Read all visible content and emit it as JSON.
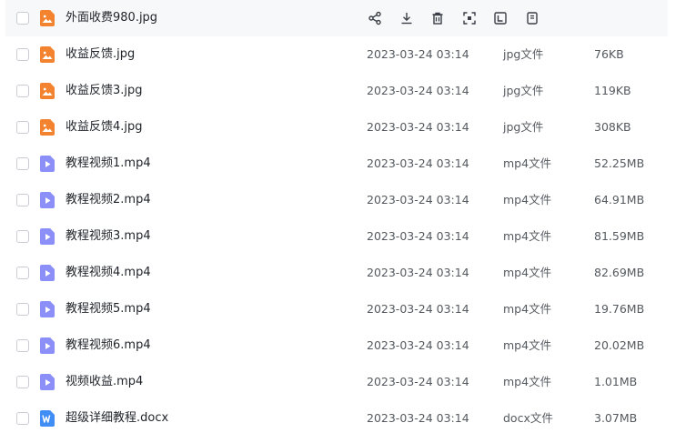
{
  "hover_actions": [
    {
      "icon": "share-icon"
    },
    {
      "icon": "download-icon"
    },
    {
      "icon": "delete-icon"
    },
    {
      "icon": "scan-icon"
    },
    {
      "icon": "text-extract-icon"
    },
    {
      "icon": "more-icon"
    }
  ],
  "files": [
    {
      "name": "外面收费980.jpg",
      "time": "",
      "type": "",
      "size": "",
      "kind": "image",
      "icon": "image-file-icon",
      "color": "#f4832f"
    },
    {
      "name": "收益反馈.jpg",
      "time": "2023-03-24 03:14",
      "type": "jpg文件",
      "size": "76KB",
      "kind": "image",
      "icon": "image-file-icon",
      "color": "#f4832f"
    },
    {
      "name": "收益反馈3.jpg",
      "time": "2023-03-24 03:14",
      "type": "jpg文件",
      "size": "119KB",
      "kind": "image",
      "icon": "image-file-icon",
      "color": "#f4832f"
    },
    {
      "name": "收益反馈4.jpg",
      "time": "2023-03-24 03:14",
      "type": "jpg文件",
      "size": "308KB",
      "kind": "image",
      "icon": "image-file-icon",
      "color": "#f4832f"
    },
    {
      "name": "教程视频1.mp4",
      "time": "2023-03-24 03:14",
      "type": "mp4文件",
      "size": "52.25MB",
      "kind": "video",
      "icon": "video-file-icon",
      "color": "#8b8ff7"
    },
    {
      "name": "教程视频2.mp4",
      "time": "2023-03-24 03:14",
      "type": "mp4文件",
      "size": "64.91MB",
      "kind": "video",
      "icon": "video-file-icon",
      "color": "#8b8ff7"
    },
    {
      "name": "教程视频3.mp4",
      "time": "2023-03-24 03:14",
      "type": "mp4文件",
      "size": "81.59MB",
      "kind": "video",
      "icon": "video-file-icon",
      "color": "#8b8ff7"
    },
    {
      "name": "教程视频4.mp4",
      "time": "2023-03-24 03:14",
      "type": "mp4文件",
      "size": "82.69MB",
      "kind": "video",
      "icon": "video-file-icon",
      "color": "#8b8ff7"
    },
    {
      "name": "教程视频5.mp4",
      "time": "2023-03-24 03:14",
      "type": "mp4文件",
      "size": "19.76MB",
      "kind": "video",
      "icon": "video-file-icon",
      "color": "#8b8ff7"
    },
    {
      "name": "教程视频6.mp4",
      "time": "2023-03-24 03:14",
      "type": "mp4文件",
      "size": "20.02MB",
      "kind": "video",
      "icon": "video-file-icon",
      "color": "#8b8ff7"
    },
    {
      "name": "视频收益.mp4",
      "time": "2023-03-24 03:14",
      "type": "mp4文件",
      "size": "1.01MB",
      "kind": "video",
      "icon": "video-file-icon",
      "color": "#8b8ff7"
    },
    {
      "name": "超级详细教程.docx",
      "time": "2023-03-24 03:14",
      "type": "docx文件",
      "size": "3.07MB",
      "kind": "word",
      "icon": "word-file-icon",
      "color": "#3f8df5"
    }
  ]
}
